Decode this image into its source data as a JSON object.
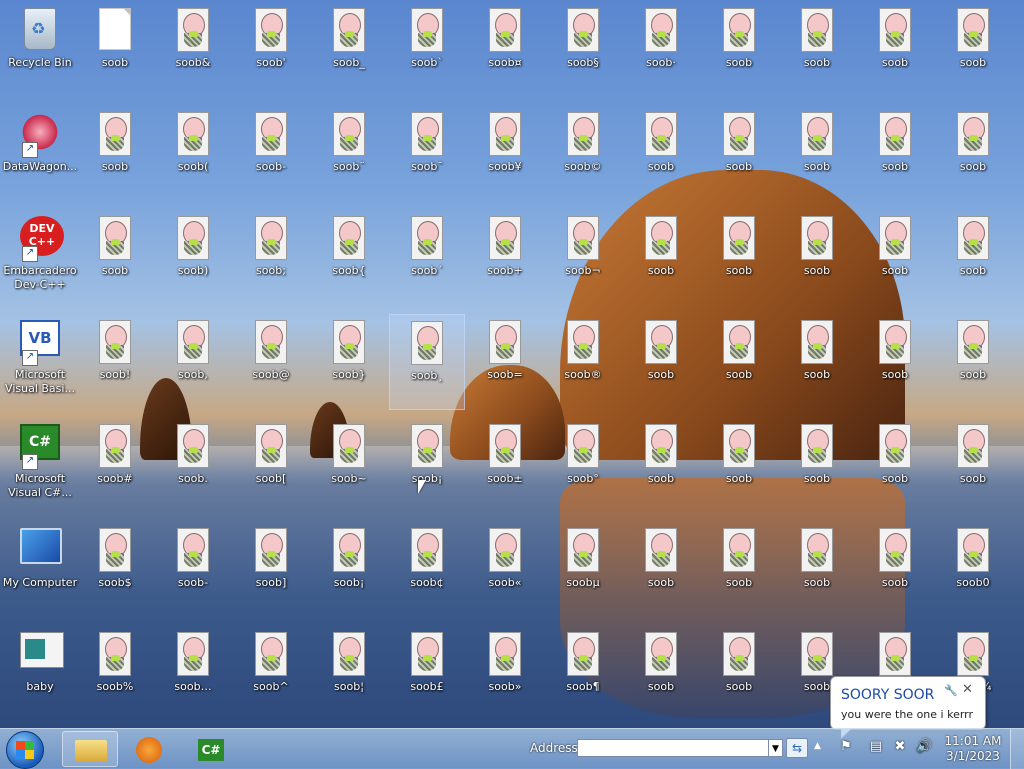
{
  "desktop": {
    "system_icons": [
      {
        "name": "recycle-bin",
        "label": "Recycle Bin"
      },
      {
        "name": "datawagon",
        "label": "DataWagon..."
      },
      {
        "name": "embarcadero-dev-cpp",
        "label": "Embarcadero Dev-C++"
      },
      {
        "name": "visual-basic",
        "label": "Microsoft Visual Basi..."
      },
      {
        "name": "visual-csharp",
        "label": "Microsoft Visual C#..."
      },
      {
        "name": "my-computer",
        "label": "My Computer"
      },
      {
        "name": "baby",
        "label": "baby"
      }
    ],
    "grid_labels": [
      [
        "soob",
        "soob&",
        "soob'",
        "soob_",
        "soob`",
        "soob¤",
        "soob§",
        "soob·",
        "soob",
        "soob",
        "soob",
        "soob"
      ],
      [
        "soob",
        "soob(",
        "soob-",
        "soob¨",
        "soob¯",
        "soob¥",
        "soob©",
        "soob",
        "soob",
        "soob",
        "soob",
        "soob"
      ],
      [
        "soob",
        "soob)",
        "soob;",
        "soob{",
        "soob´",
        "soob+",
        "soob¬",
        "soob",
        "soob",
        "soob",
        "soob",
        "soob"
      ],
      [
        "soob!",
        "soob,",
        "soob@",
        "soob}",
        "soob¸",
        "soob=",
        "soob®",
        "soob",
        "soob",
        "soob",
        "soob",
        "soob"
      ],
      [
        "soob#",
        "soob.",
        "soob[",
        "soob~",
        "soob¡",
        "soob±",
        "soob°",
        "soob",
        "soob",
        "soob",
        "soob",
        "soob"
      ],
      [
        "soob$",
        "soob-",
        "soob]",
        "soob¡",
        "soob¢",
        "soob«",
        "soobµ",
        "soob",
        "soob",
        "soob",
        "soob",
        "soob0"
      ],
      [
        "soob%",
        "soob…",
        "soob^",
        "soob¦",
        "soob£",
        "soob»",
        "soob¶",
        "soob",
        "soob",
        "soob",
        "soob",
        "soob¼"
      ]
    ]
  },
  "taskbar": {
    "address_label": "Address",
    "address_value": "",
    "go_symbol": "⇆",
    "dropdown_symbol": "▼",
    "time": "11:01 AM",
    "date": "3/1/2023",
    "csharp_label": "C#"
  },
  "balloon": {
    "title": "SOORY SOOR",
    "message": "you were the one i kerrr",
    "close_symbol": "✕",
    "wrench_symbol": "🔧"
  },
  "icon_text": {
    "dev": "DEV C++",
    "vb": "VB",
    "cs": "C#",
    "shortcut": "↗"
  }
}
